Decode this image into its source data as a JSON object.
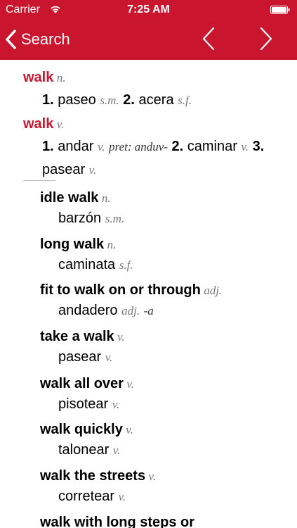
{
  "status_bar": {
    "carrier": "Carrier",
    "time": "7:25 AM"
  },
  "nav": {
    "back_label": "Search",
    "back_icon": "chevron-left-icon",
    "prev_icon": "chevron-left-icon",
    "next_icon": "chevron-right-icon"
  },
  "colors": {
    "accent": "#c9152d",
    "pos_gray": "#777777"
  },
  "entries": [
    {
      "headword": "walk",
      "pos": "n.",
      "senses": [
        {
          "num": "1.",
          "word": "paseo",
          "gram": "s.m."
        },
        {
          "num": "2.",
          "word": "acera",
          "gram": "s.f."
        }
      ]
    },
    {
      "headword": "walk",
      "pos": "v.",
      "senses": [
        {
          "num": "1.",
          "word": "andar",
          "gram": "v.",
          "note": "pret: anduv-"
        },
        {
          "num": "2.",
          "word": "caminar",
          "gram": "v."
        },
        {
          "num": "3.",
          "word": "pasear",
          "gram": "v."
        }
      ]
    }
  ],
  "phrases": [
    {
      "phrase": "idle walk",
      "pos": "n.",
      "translation": "barzón",
      "gram": "s.m."
    },
    {
      "phrase": "long walk",
      "pos": "n.",
      "translation": "caminata",
      "gram": "s.f."
    },
    {
      "phrase": "fit to walk on or through",
      "pos": "adj.",
      "translation": "andadero",
      "gram": "adj.",
      "suffix": "-a"
    },
    {
      "phrase": "take a walk",
      "pos": "v.",
      "translation": "pasear",
      "gram": "v."
    },
    {
      "phrase": "walk all over",
      "pos": "v.",
      "translation": "pisotear",
      "gram": "v."
    },
    {
      "phrase": "walk quickly",
      "pos": "v.",
      "translation": "talonear",
      "gram": "v."
    },
    {
      "phrase": "walk the streets",
      "pos": "v.",
      "translation": "corretear",
      "gram": "v."
    },
    {
      "phrase": "walk with long steps or",
      "pos": "",
      "translation": "",
      "gram": ""
    }
  ]
}
